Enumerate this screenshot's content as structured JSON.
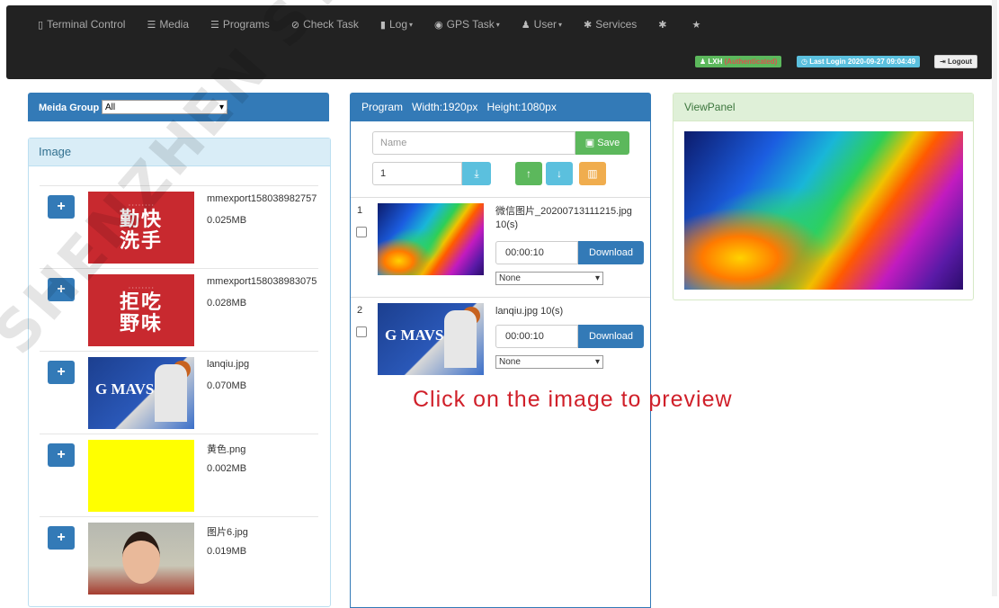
{
  "nav": {
    "items": [
      {
        "icon": "tablet-icon",
        "glyph": "▯",
        "label": "Terminal Control",
        "caret": false
      },
      {
        "icon": "media-icon",
        "glyph": "☰",
        "label": "Media",
        "caret": false
      },
      {
        "icon": "programs-icon",
        "glyph": "☰",
        "label": "Programs",
        "caret": false
      },
      {
        "icon": "check-icon",
        "glyph": "⊘",
        "label": "Check Task",
        "caret": false
      },
      {
        "icon": "file-icon",
        "glyph": "▮",
        "label": "Log",
        "caret": true
      },
      {
        "icon": "globe-icon",
        "glyph": "◉",
        "label": "GPS Task",
        "caret": true
      },
      {
        "icon": "user-icon",
        "glyph": "♟",
        "label": "User",
        "caret": true
      },
      {
        "icon": "asterisk-icon",
        "glyph": "✱",
        "label": "Services",
        "caret": false
      },
      {
        "icon": "asterisk-icon",
        "glyph": "✱",
        "label": "",
        "caret": false
      },
      {
        "icon": "star-icon",
        "glyph": "★",
        "label": "",
        "caret": false
      }
    ],
    "user_name": "LXH",
    "user_status": "(Authenticated)",
    "last_login": "Last Login 2020-09-27 09:04:49",
    "logout": "Logout"
  },
  "media": {
    "group_label": "Meida Group",
    "group_value": "All",
    "image_header": "Image",
    "images": [
      {
        "name": "mmexport158038982757",
        "size": "0.025MB",
        "thumb": "red",
        "thumb_text": "勤快洗手"
      },
      {
        "name": "mmexport158038983075",
        "size": "0.028MB",
        "thumb": "red",
        "thumb_text": "拒吃野味"
      },
      {
        "name": "lanqiu.jpg",
        "size": "0.070MB",
        "thumb": "bball",
        "thumb_text": "G MAVS"
      },
      {
        "name": "黄色.png",
        "size": "0.002MB",
        "thumb": "yellow",
        "thumb_text": ""
      },
      {
        "name": "图片6.jpg",
        "size": "0.019MB",
        "thumb": "girl",
        "thumb_text": ""
      }
    ]
  },
  "program": {
    "title": "Program",
    "width": "Width:1920px",
    "height": "Height:1080px",
    "name_placeholder": "Name",
    "save": "Save",
    "page_value": "1",
    "rows": [
      {
        "index": "1",
        "file": "微信图片_20200713111215.jpg 10(s)",
        "time": "00:00:10",
        "download": "Download",
        "transition": "None",
        "thumb": "wave"
      },
      {
        "index": "2",
        "file": "lanqiu.jpg 10(s)",
        "time": "00:00:10",
        "download": "Download",
        "transition": "None",
        "thumb": "bball"
      }
    ]
  },
  "view": {
    "title": "ViewPanel"
  },
  "hint": "Click on the image to preview",
  "watermark": "SHENZHEN SYSOLUTION"
}
